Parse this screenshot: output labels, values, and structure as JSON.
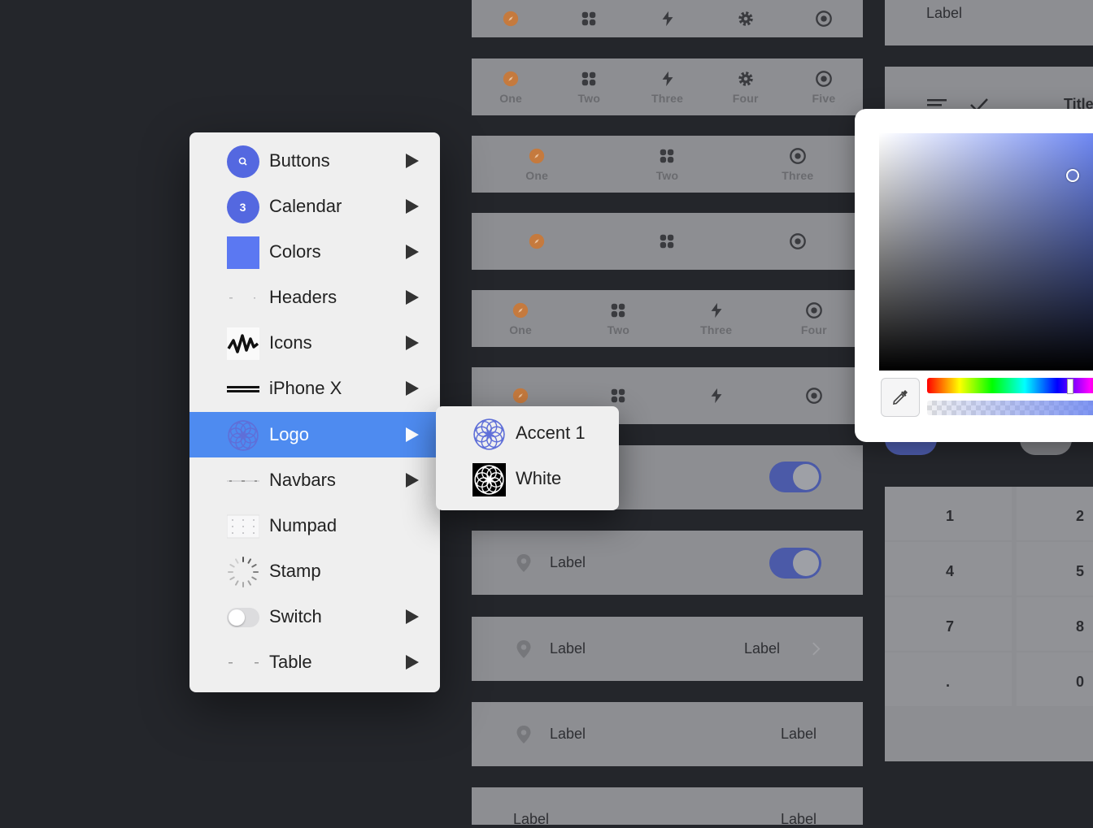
{
  "tabbars": [
    {
      "labels": []
    },
    {
      "labels": [
        "One",
        "Two",
        "Three",
        "Four",
        "Five"
      ]
    },
    {
      "labels": [
        "One",
        "Two",
        "Three"
      ]
    },
    {
      "labels": []
    },
    {
      "labels": [
        "One",
        "Two",
        "Three",
        "Four"
      ]
    },
    {
      "labels": []
    }
  ],
  "rows": {
    "toggle_row": {
      "label": "Label"
    },
    "chevron_row": {
      "label": "Label",
      "value": "Label"
    },
    "value_row": {
      "label": "Label",
      "value": "Label"
    },
    "bottom_row": {
      "label": "Label",
      "value": "Label"
    }
  },
  "right_panel": {
    "top_label": "Label",
    "title_fragment": "Title",
    "numpad": [
      "1",
      "2",
      "4",
      "5",
      "7",
      "8",
      ".",
      "0"
    ]
  },
  "color_picker": {
    "base_color": "#5b78f2"
  },
  "menu": {
    "items": [
      {
        "label": "Buttons",
        "icon": "search-circle-icon",
        "has_submenu": true
      },
      {
        "label": "Calendar",
        "icon": "calendar-badge-icon",
        "badge": "3",
        "has_submenu": true
      },
      {
        "label": "Colors",
        "icon": "color-swatch-icon",
        "has_submenu": true
      },
      {
        "label": "Headers",
        "icon": "headers-thumbnail-icon",
        "has_submenu": true
      },
      {
        "label": "Icons",
        "icon": "waveform-icon",
        "has_submenu": true
      },
      {
        "label": "iPhone X",
        "icon": "iphone-x-bar-icon",
        "has_submenu": true
      },
      {
        "label": "Logo",
        "icon": "logo-rosette-icon",
        "has_submenu": true,
        "selected": true
      },
      {
        "label": "Navbars",
        "icon": "navbars-thumbnail-icon",
        "has_submenu": true
      },
      {
        "label": "Numpad",
        "icon": "numpad-thumbnail-icon",
        "has_submenu": false
      },
      {
        "label": "Stamp",
        "icon": "loading-spinner-icon",
        "has_submenu": false
      },
      {
        "label": "Switch",
        "icon": "switch-thumbnail-icon",
        "has_submenu": true
      },
      {
        "label": "Table",
        "icon": "table-thumbnail-icon",
        "has_submenu": true
      }
    ],
    "submenu": [
      {
        "label": "Accent 1",
        "icon": "logo-accent-icon"
      },
      {
        "label": "White",
        "icon": "logo-white-icon"
      }
    ]
  },
  "colors": {
    "accent": "#4e8bf0",
    "brand_blue": "#5468e0",
    "orange_icon": "#c57a3e"
  }
}
